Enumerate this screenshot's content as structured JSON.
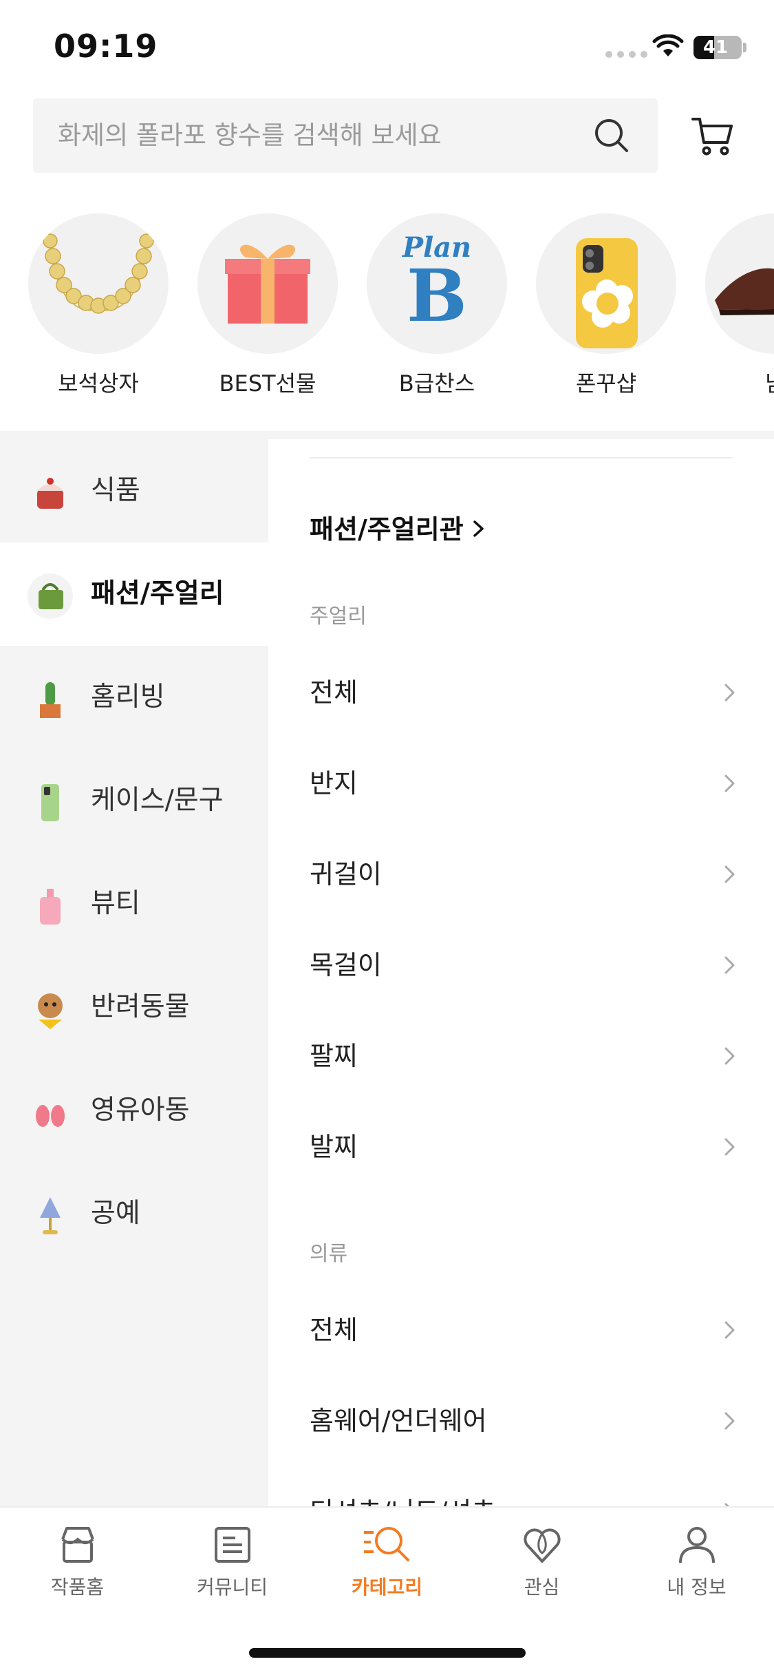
{
  "status_bar": {
    "time": "09:19",
    "battery": "41"
  },
  "search": {
    "placeholder": "화제의 폴라포 향수를 검색해 보세요"
  },
  "shortcuts": [
    {
      "label": "보석상자",
      "icon": "necklace-image"
    },
    {
      "label": "BEST선물",
      "icon": "gift-box-image"
    },
    {
      "label": "B급찬스",
      "icon": "plan-b-logo",
      "logo_text_top": "Plan",
      "logo_text_bottom": "B"
    },
    {
      "label": "폰꾸샵",
      "icon": "phone-case-image"
    },
    {
      "label": "남",
      "icon": "leather-shoe-image"
    }
  ],
  "categories": [
    {
      "label": "식품",
      "icon": "cake-thumbnail",
      "active": false
    },
    {
      "label": "패션/주얼리",
      "icon": "bag-thumbnail",
      "active": true
    },
    {
      "label": "홈리빙",
      "icon": "cactus-thumbnail",
      "active": false
    },
    {
      "label": "케이스/문구",
      "icon": "phone-case-thumbnail",
      "active": false
    },
    {
      "label": "뷰티",
      "icon": "perfume-thumbnail",
      "active": false
    },
    {
      "label": "반려동물",
      "icon": "puppy-thumbnail",
      "active": false
    },
    {
      "label": "영유아동",
      "icon": "baby-shoes-thumbnail",
      "active": false
    },
    {
      "label": "공예",
      "icon": "lamp-thumbnail",
      "active": false
    }
  ],
  "right_panel": {
    "header": "패션/주얼리관",
    "sections": [
      {
        "title": "주얼리",
        "items": [
          "전체",
          "반지",
          "귀걸이",
          "목걸이",
          "팔찌",
          "발찌"
        ]
      },
      {
        "title": "의류",
        "items": [
          "전체",
          "홈웨어/언더웨어",
          "티셔츠/니트/셔츠"
        ]
      }
    ]
  },
  "tabbar": [
    {
      "label": "작품홈",
      "icon": "shop-icon",
      "active": false
    },
    {
      "label": "커뮤니티",
      "icon": "community-icon",
      "active": false
    },
    {
      "label": "카테고리",
      "icon": "category-search-icon",
      "active": true
    },
    {
      "label": "관심",
      "icon": "heart-icon",
      "active": false
    },
    {
      "label": "내 정보",
      "icon": "user-icon",
      "active": false
    }
  ],
  "colors": {
    "accent": "#f47b20",
    "sidebar_bg": "#f4f4f4",
    "text": "#222222",
    "muted": "#999999"
  }
}
